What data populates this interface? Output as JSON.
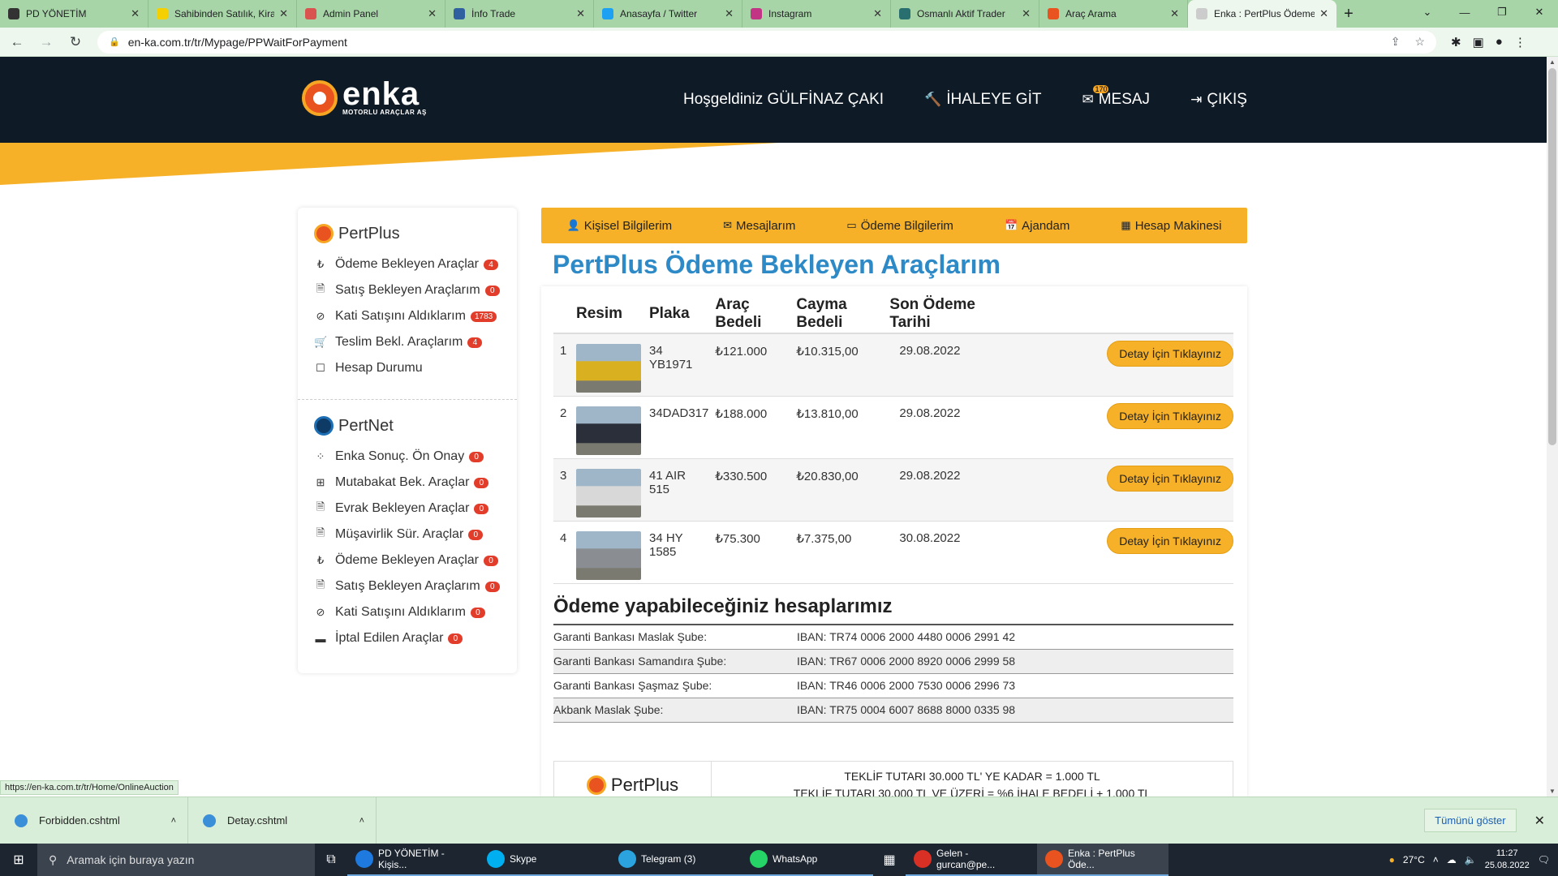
{
  "browser": {
    "tabs": [
      {
        "title": "PD YÖNETİM",
        "color": "#333333"
      },
      {
        "title": "Sahibinden Satılık, Kira",
        "color": "#f4d000"
      },
      {
        "title": "Admin Panel",
        "color": "#d9534f"
      },
      {
        "title": "İnfo Trade",
        "color": "#3060a0"
      },
      {
        "title": "Anasayfa / Twitter",
        "color": "#1da1f2"
      },
      {
        "title": "Instagram",
        "color": "#c13584"
      },
      {
        "title": "Osmanlı Aktif Trader",
        "color": "#2a6f6f"
      },
      {
        "title": "Araç Arama",
        "color": "#e8531f"
      },
      {
        "title": "Enka : PertPlus Ödeme",
        "color": "#cccccc"
      }
    ],
    "url": "en-ka.com.tr/tr/Mypage/PPWaitForPayment",
    "status_url": "https://en-ka.com.tr/tr/Home/OnlineAuction"
  },
  "header": {
    "logo_big": "enka",
    "logo_small": "MOTORLU ARAÇLAR AŞ",
    "welcome": "Hoşgeldiniz GÜLFİNAZ ÇAKI",
    "auction": "İHALEYE GİT",
    "message": "MESAJ",
    "message_badge": "170",
    "logout": "ÇIKIŞ"
  },
  "sidebar": {
    "pertplus_title": "PertPlus",
    "pertplus_items": [
      {
        "icon": "₺",
        "label": "Ödeme Bekleyen Araçlar",
        "count": "4"
      },
      {
        "icon": "🗎",
        "label": "Satış Bekleyen Araçlarım",
        "count": "0"
      },
      {
        "icon": "⊘",
        "label": "Kati Satışını Aldıklarım",
        "count": "1783"
      },
      {
        "icon": "🛒",
        "label": "Teslim Bekl. Araçlarım",
        "count": "4"
      },
      {
        "icon": "☐",
        "label": "Hesap Durumu",
        "count": ""
      }
    ],
    "pertnet_title": "PertNet",
    "pertnet_items": [
      {
        "icon": "⁘",
        "label": "Enka Sonuç. Ön Onay",
        "count": "0"
      },
      {
        "icon": "⊞",
        "label": "Mutabakat Bek. Araçlar",
        "count": "0"
      },
      {
        "icon": "🗎",
        "label": "Evrak Bekleyen Araçlar",
        "count": "0"
      },
      {
        "icon": "🗎",
        "label": "Müşavirlik Sür. Araçlar",
        "count": "0"
      },
      {
        "icon": "₺",
        "label": "Ödeme Bekleyen Araçlar",
        "count": "0"
      },
      {
        "icon": "🗎",
        "label": "Satış Bekleyen Araçlarım",
        "count": "0"
      },
      {
        "icon": "⊘",
        "label": "Kati Satışını Aldıklarım",
        "count": "0"
      },
      {
        "icon": "▬",
        "label": "İptal Edilen Araçlar",
        "count": "0"
      }
    ]
  },
  "menu": [
    {
      "icon": "👤",
      "label": "Kişisel Bilgilerim"
    },
    {
      "icon": "✉",
      "label": "Mesajlarım"
    },
    {
      "icon": "▭",
      "label": "Ödeme Bilgilerim"
    },
    {
      "icon": "📅",
      "label": "Ajandam"
    },
    {
      "icon": "▦",
      "label": "Hesap Makinesi"
    }
  ],
  "page_title": "PertPlus Ödeme Bekleyen Araçlarım",
  "table": {
    "headers": [
      "",
      "Resim",
      "Plaka",
      "Araç Bedeli",
      "Cayma Bedeli",
      "Son Ödeme Tarihi",
      ""
    ],
    "rows": [
      {
        "no": "1",
        "plate": "34 YB1971",
        "price": "₺121.000",
        "fee": "₺10.315,00",
        "date": "29.08.2022",
        "btn": "Detay İçin Tıklayınız",
        "thumb": "#d8b020"
      },
      {
        "no": "2",
        "plate": "34DAD317",
        "price": "₺188.000",
        "fee": "₺13.810,00",
        "date": "29.08.2022",
        "btn": "Detay İçin Tıklayınız",
        "thumb": "#2a2f3a"
      },
      {
        "no": "3",
        "plate": "41 AIR 515",
        "price": "₺330.500",
        "fee": "₺20.830,00",
        "date": "29.08.2022",
        "btn": "Detay İçin Tıklayınız",
        "thumb": "#d8d8d8"
      },
      {
        "no": "4",
        "plate": "34 HY 1585",
        "price": "₺75.300",
        "fee": "₺7.375,00",
        "date": "30.08.2022",
        "btn": "Detay İçin Tıklayınız",
        "thumb": "#8a8e92"
      }
    ]
  },
  "accounts": {
    "title": "Ödeme yapabileceğiniz hesaplarımız",
    "rows": [
      {
        "bank": "Garanti Bankası Maslak Şube:",
        "iban": "IBAN: TR74 0006 2000 4480 0006 2991 42"
      },
      {
        "bank": "Garanti Bankası Samandıra Şube:",
        "iban": "IBAN: TR67 0006 2000 8920 0006 2999 58"
      },
      {
        "bank": "Garanti Bankası Şaşmaz Şube:",
        "iban": "IBAN: TR46 0006 2000 7530 0006 2996 73"
      },
      {
        "bank": "Akbank Maslak Şube:",
        "iban": "IBAN: TR75 0004 6007 8688 8000 0335 98"
      }
    ]
  },
  "pertbox": {
    "title": "PertPlus",
    "line1": "TEKLİF TUTARI 30.000 TL' YE KADAR = 1.000 TL",
    "line2": "TEKLİF TUTARI 30.000 TL VE ÜZERİ = %6 İHALE BEDELİ + 1.000 TL"
  },
  "downloads": {
    "items": [
      "Forbidden.cshtml",
      "Detay.cshtml"
    ],
    "show_all": "Tümünü göster"
  },
  "taskbar": {
    "search": "Aramak için buraya yazın",
    "apps": [
      {
        "label": "PD YÖNETİM - Kişis...",
        "color": "#1f7ae0"
      },
      {
        "label": "Skype",
        "color": "#00aff0"
      },
      {
        "label": "Telegram (3)",
        "color": "#2aa3df"
      },
      {
        "label": "WhatsApp",
        "color": "#25d366"
      },
      {
        "label": "Gelen - gurcan@pe...",
        "color": "#d93025"
      },
      {
        "label": "Enka : PertPlus Öde...",
        "color": "#e8531f"
      }
    ],
    "temp": "27°C",
    "time": "11:27",
    "date": "25.08.2022"
  }
}
